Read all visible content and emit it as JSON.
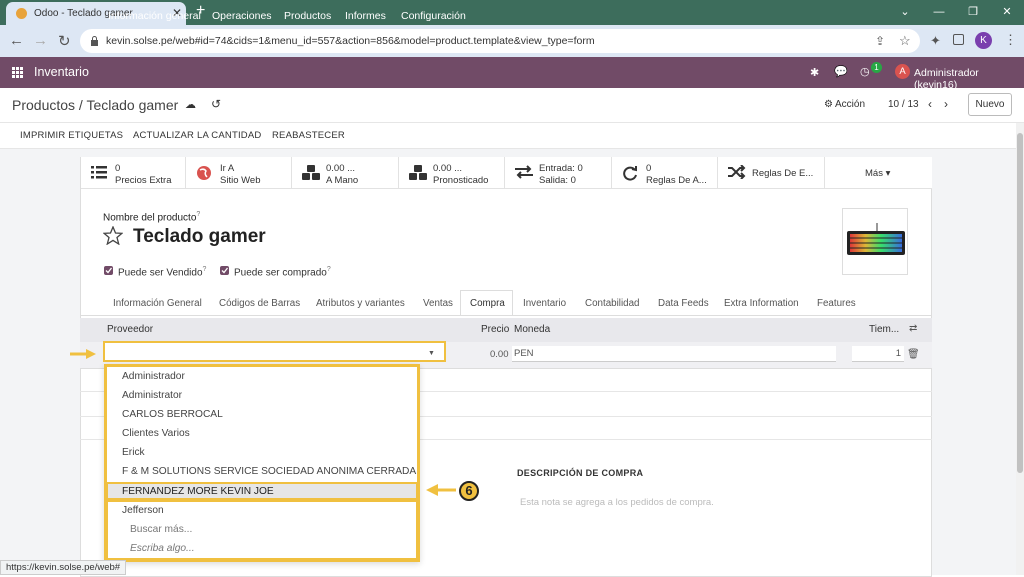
{
  "browser": {
    "tab_title": "Odoo - Teclado gamer",
    "url": "kevin.solse.pe/web#id=74&cids=1&menu_id=557&action=856&model=product.template&view_type=form",
    "profile_initial": "K",
    "status_url": "https://kevin.solse.pe/web#"
  },
  "navbar": {
    "app_name": "Inventario",
    "menu": [
      "Información general",
      "Operaciones",
      "Productos",
      "Informes",
      "Configuración"
    ],
    "activity_count": "1",
    "user_initial": "A",
    "user_name": "Administrador (kevin16)"
  },
  "control": {
    "breadcrumb": "Productos / Teclado gamer",
    "action_label": "Acción",
    "pager": "10 / 13",
    "new_button": "Nuevo"
  },
  "actions": [
    "IMPRIMIR ETIQUETAS",
    "ACTUALIZAR LA CANTIDAD",
    "REABASTECER"
  ],
  "stats": [
    {
      "line1": "0",
      "line2": "Precios Extra",
      "icon": "list-icon"
    },
    {
      "line1": "Ir A",
      "line2": "Sitio Web",
      "icon": "globe-icon"
    },
    {
      "line1": "0.00 ...",
      "line2": "A Mano",
      "icon": "cubes-icon"
    },
    {
      "line1": "0.00 ...",
      "line2": "Pronosticado",
      "icon": "cubes-icon"
    },
    {
      "line1": "Entrada:   0",
      "line2": "Salida:     0",
      "icon": "exchange-icon"
    },
    {
      "line1": "0",
      "line2": "Reglas De A...",
      "icon": "refresh-icon"
    },
    {
      "line1": "Reglas De E...",
      "line2": "",
      "icon": "shuffle-icon"
    },
    {
      "line1": "Más ▾",
      "line2": "",
      "icon": ""
    }
  ],
  "product": {
    "name_label": "Nombre del producto",
    "name": "Teclado gamer",
    "can_be_sold": "Puede ser Vendido",
    "can_be_purchased": "Puede ser comprado"
  },
  "tabs": [
    "Información General",
    "Códigos de Barras",
    "Atributos y variantes",
    "Ventas",
    "Compra",
    "Inventario",
    "Contabilidad",
    "Data Feeds",
    "Extra Information",
    "Features"
  ],
  "vendor_table": {
    "headers": {
      "proveedor": "Proveedor",
      "precio": "Precio",
      "moneda": "Moneda",
      "tiempo": "Tiem..."
    },
    "row": {
      "precio": "0.00",
      "moneda": "PEN",
      "tiempo": "1"
    }
  },
  "dropdown": {
    "options": [
      "Administrador",
      "Administrator",
      "CARLOS BERROCAL",
      "Clientes Varios",
      "Erick",
      "F & M SOLUTIONS SERVICE SOCIEDAD ANONIMA CERRADA",
      "FERNANDEZ MORE KEVIN JOE",
      "Jefferson"
    ],
    "search_more": "Buscar más...",
    "type_something": "Escriba algo..."
  },
  "purchase_desc": {
    "label": "DESCRIPCIÓN DE COMPRA",
    "placeholder": "Esta nota se agrega a los pedidos de compra."
  },
  "annotation": {
    "step": "6"
  },
  "colors": {
    "navbar": "#714b67",
    "highlight": "#f0c040",
    "tabbar": "#3d6d5c"
  }
}
